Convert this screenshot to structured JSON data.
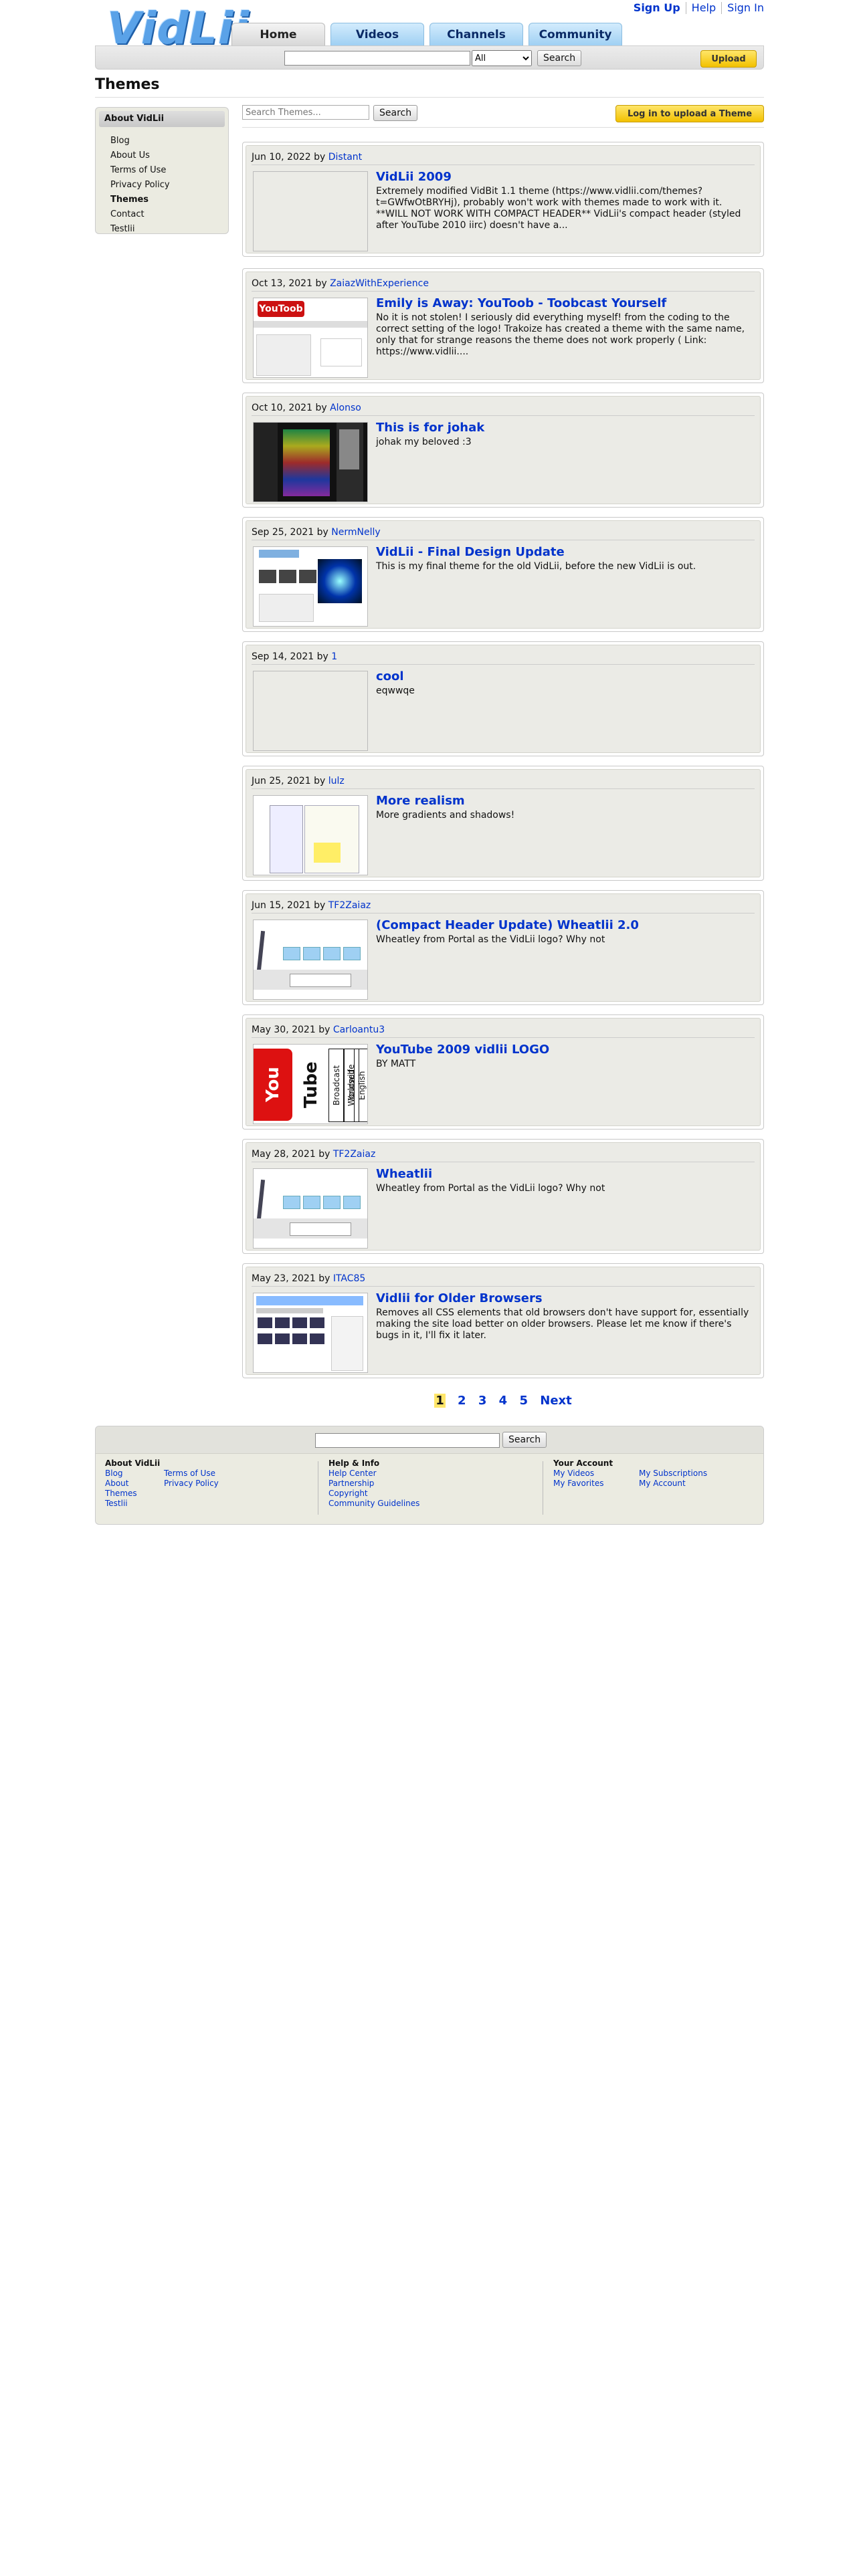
{
  "header": {
    "logo_text": "VidLii",
    "tabs": [
      {
        "label": "Home",
        "active": true
      },
      {
        "label": "Videos",
        "active": false
      },
      {
        "label": "Channels",
        "active": false
      },
      {
        "label": "Community",
        "active": false
      }
    ],
    "top_links": {
      "sign_up": "Sign Up",
      "help": "Help",
      "sign_in": "Sign In"
    },
    "search": {
      "value": "",
      "scope_selected": "All",
      "button": "Search"
    },
    "upload_button": "Upload"
  },
  "page": {
    "title": "Themes"
  },
  "sidebar": {
    "heading": "About VidLii",
    "items": [
      {
        "label": "Blog",
        "selected": false
      },
      {
        "label": "About Us",
        "selected": false
      },
      {
        "label": "Terms of Use",
        "selected": false
      },
      {
        "label": "Privacy Policy",
        "selected": false
      },
      {
        "label": "Themes",
        "selected": true
      },
      {
        "label": "Contact",
        "selected": false
      },
      {
        "label": "Testlii",
        "selected": false
      }
    ]
  },
  "themes_toolbar": {
    "search_placeholder": "Search Themes...",
    "search_button": "Search",
    "login_upload_button": "Log in to upload a Theme"
  },
  "themes": [
    {
      "date": "Jun 10, 2022",
      "by": "by",
      "author": "Distant",
      "title": "VidLii 2009",
      "desc": "Extremely modified VidBit 1.1 theme (https://www.vidlii.com/themes?t=GWfwOtBRYHj), probably won't work with themes made to work with it. **WILL NOT WORK WITH COMPACT HEADER** VidLii's compact header (styled after YouTube 2010 iirc) doesn't have a..."
    },
    {
      "date": "Oct 13, 2021",
      "by": "by",
      "author": "ZaiazWithExperience",
      "title": "Emily is Away: YouToob - Toobcast Yourself",
      "desc": "No it is not stolen! I seriously did everything myself! from the coding to the correct setting of the logo! Trakoize has created a theme with the same name, only that for strange reasons the theme does not work properly ( Link: https://www.vidlii...."
    },
    {
      "date": "Oct 10, 2021",
      "by": "by",
      "author": "Alonso",
      "title": "This is for johak",
      "desc": "johak my beloved :3"
    },
    {
      "date": "Sep 25, 2021",
      "by": "by",
      "author": "NermNelly",
      "title": "VidLii - Final Design Update",
      "desc": "This is my final theme for the old VidLii, before the new VidLii is out."
    },
    {
      "date": "Sep 14, 2021",
      "by": "by",
      "author": "1",
      "title": "cool",
      "desc": "eqwwqe"
    },
    {
      "date": "Jun 25, 2021",
      "by": "by",
      "author": "lulz",
      "title": "More realism",
      "desc": "More gradients and shadows!"
    },
    {
      "date": "Jun 15, 2021",
      "by": "by",
      "author": "TF2Zaiaz",
      "title": "(Compact Header Update) Wheatlii 2.0",
      "desc": "Wheatley from Portal as the VidLii logo? Why not"
    },
    {
      "date": "May 30, 2021",
      "by": "by",
      "author": "Carloantu3",
      "title": "YouTube 2009 vidlii LOGO",
      "desc": "BY MATT"
    },
    {
      "date": "May 28, 2021",
      "by": "by",
      "author": "TF2Zaiaz",
      "title": "Wheatlii",
      "desc": "Wheatley from Portal as the VidLii logo? Why not"
    },
    {
      "date": "May 23, 2021",
      "by": "by",
      "author": "ITAC85",
      "title": "Vidlii for Older Browsers",
      "desc": "Removes all CSS elements that old browsers don't have support for, essentially making the site load better on older browsers. Please let me know if there's bugs in it, I'll fix it later."
    }
  ],
  "thumb_text": {
    "toob": "YouToob",
    "yt_you": "You",
    "yt_tube": "Tube",
    "yt_cols": [
      "Broadcast Yourself",
      "Worldwide",
      "English"
    ]
  },
  "pagination": {
    "pages": [
      "1",
      "2",
      "3",
      "4",
      "5"
    ],
    "current": "1",
    "next": "Next"
  },
  "footer": {
    "search_button": "Search",
    "about": {
      "heading": "About VidLii",
      "col1": [
        "Blog",
        "About",
        "Themes",
        "Testlii"
      ],
      "col2": [
        "Terms of Use",
        "Privacy Policy"
      ]
    },
    "help": {
      "heading": "Help & Info",
      "links": [
        "Help Center",
        "Partnership",
        "Copyright",
        "Community Guidelines"
      ]
    },
    "account": {
      "heading": "Your Account",
      "col1": [
        "My Videos",
        "My Favorites"
      ],
      "col2": [
        "My Subscriptions",
        "My Account"
      ]
    }
  }
}
